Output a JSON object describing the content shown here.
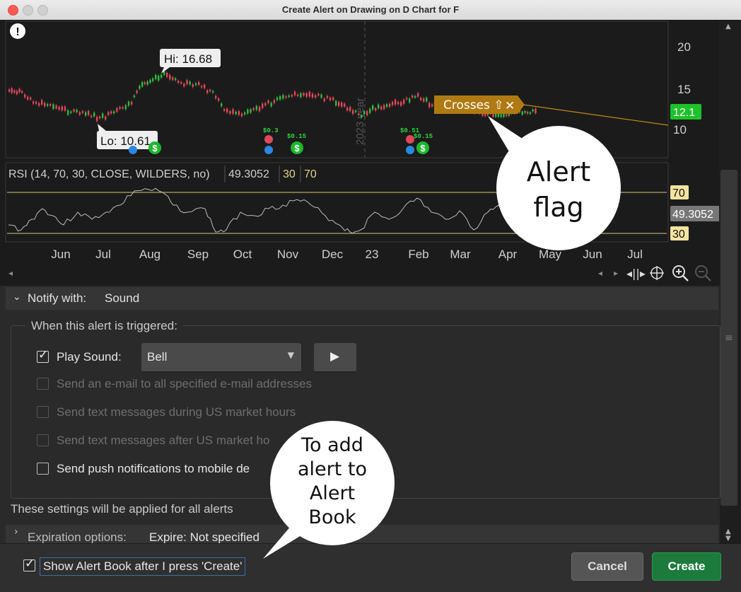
{
  "window": {
    "title": "Create Alert on Drawing on D Chart for F"
  },
  "chart": {
    "price_axis_labels": [
      "20",
      "15",
      "10"
    ],
    "last_price_badge": "12.1",
    "hi_label": "Hi: 16.68",
    "lo_label": "Lo: 10.61",
    "year_marker": "2023 year",
    "dividend_labels": [
      "$0.3",
      "$0.15",
      "$0.51",
      "$0.15"
    ],
    "crosses_flag": "Crosses ⇧",
    "crosses_close": "✕",
    "rsi_header": "RSI (14, 70, 30, CLOSE, WILDERS, no)",
    "rsi_value": "49.3052",
    "rsi_over": "30",
    "rsi_under": "70",
    "rsi_axis_labels": [
      "70",
      "49.3052",
      "30"
    ],
    "months": [
      "Jun",
      "Jul",
      "Aug",
      "Sep",
      "Oct",
      "Nov",
      "Dec",
      "23",
      "Feb",
      "Mar",
      "Apr",
      "May",
      "Jun",
      "Jul"
    ],
    "colors": {
      "up": "#2fbd3a",
      "down": "#e0485a",
      "rsi_line": "#bdbdbd",
      "rsi_bound": "#d8c67e",
      "flag": "#b07a12",
      "badge": "#1ec22a"
    }
  },
  "notify": {
    "label": "Notify with:",
    "value": "Sound",
    "group_title": "When this alert is triggered:",
    "play_sound_label": "Play Sound:",
    "sound_select": "Bell",
    "options": [
      "Send an e-mail to all specified e-mail addresses",
      "Send text messages during US market hours",
      "Send text messages after US market ho",
      "Send push notifications to mobile de"
    ],
    "settings_note": "These settings will be applied for all alerts"
  },
  "expiration": {
    "label": "Expiration options:",
    "value": "Expire: Not specified"
  },
  "footer": {
    "show_book_label": "Show Alert Book after I press 'Create'",
    "cancel": "Cancel",
    "create": "Create"
  },
  "callouts": {
    "alert_flag": [
      "Alert",
      "flag"
    ],
    "alert_book": [
      "To add",
      "alert to",
      "Alert",
      "Book"
    ]
  }
}
